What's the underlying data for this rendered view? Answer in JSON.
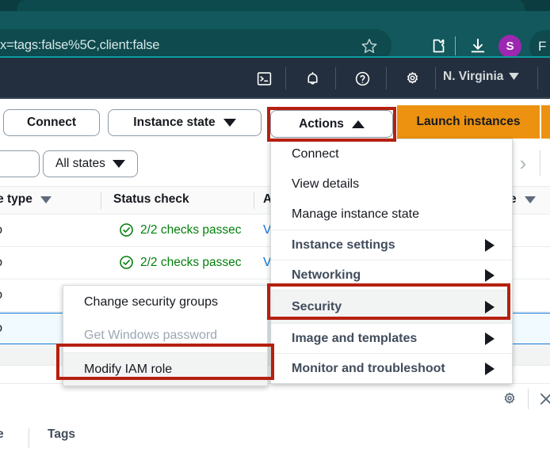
{
  "browser": {
    "url_text": "x=tags:false%5C,client:false",
    "icons": {
      "bookmark": "star-icon",
      "extensions": "puzzle-piece-icon",
      "downloads": "download-icon"
    },
    "avatar_initial": "S",
    "profile_label": "F"
  },
  "aws_nav": {
    "cloudshell": "cloudshell-icon",
    "notifications": "bell-icon",
    "help": "help-circle-icon",
    "settings": "gear-icon",
    "region": "N. Virginia"
  },
  "toolbar": {
    "connect": "Connect",
    "instance_state": "Instance state",
    "actions": "Actions",
    "launch_instances": "Launch instances"
  },
  "filters": {
    "all_states": "All states",
    "next_page": "›"
  },
  "table": {
    "columns": [
      {
        "label": "nce type",
        "sortable": true
      },
      {
        "label": "Status check",
        "sortable": false
      },
      {
        "label": "A",
        "sortable": false
      },
      {
        "label": "e",
        "sortable": true
      }
    ],
    "rows": [
      {
        "instance_type": "icro",
        "status_check": "2/2 checks passec",
        "az": "V",
        "selected": false
      },
      {
        "instance_type": "icro",
        "status_check": "2/2 checks passec",
        "az": "V",
        "selected": false
      },
      {
        "instance_type": "icro",
        "status_check": "",
        "az": "",
        "selected": false
      },
      {
        "instance_type": "icro",
        "status_check": "",
        "az": "",
        "selected": true
      }
    ]
  },
  "actions_menu": {
    "items": [
      {
        "label": "Connect",
        "type": "plain",
        "submenu": false,
        "hovered": false
      },
      {
        "label": "View details",
        "type": "plain",
        "submenu": false,
        "hovered": false
      },
      {
        "label": "Manage instance state",
        "type": "plain",
        "submenu": false,
        "hovered": false
      },
      {
        "label": "Instance settings",
        "type": "group",
        "submenu": true,
        "hovered": false
      },
      {
        "label": "Networking",
        "type": "group",
        "submenu": true,
        "hovered": false
      },
      {
        "label": "Security",
        "type": "group",
        "submenu": true,
        "hovered": true
      },
      {
        "label": "Image and templates",
        "type": "group",
        "submenu": true,
        "hovered": false
      },
      {
        "label": "Monitor and troubleshoot",
        "type": "group",
        "submenu": true,
        "hovered": false
      }
    ]
  },
  "security_submenu": {
    "items": [
      {
        "label": "Change security groups",
        "disabled": false,
        "hovered": false
      },
      {
        "label": "Get Windows password",
        "disabled": true,
        "hovered": false
      },
      {
        "label": "Modify IAM role",
        "disabled": false,
        "hovered": true
      }
    ]
  },
  "split_panel": {
    "settings_icon": "gear-icon",
    "close_icon": "close-icon",
    "tabs": [
      {
        "label": "e"
      },
      {
        "label": "Tags"
      }
    ]
  },
  "annotations": {
    "highlight_color": "#b52010",
    "boxes": [
      "actions-button",
      "security-menu-item",
      "modify-iam-role-item"
    ]
  }
}
